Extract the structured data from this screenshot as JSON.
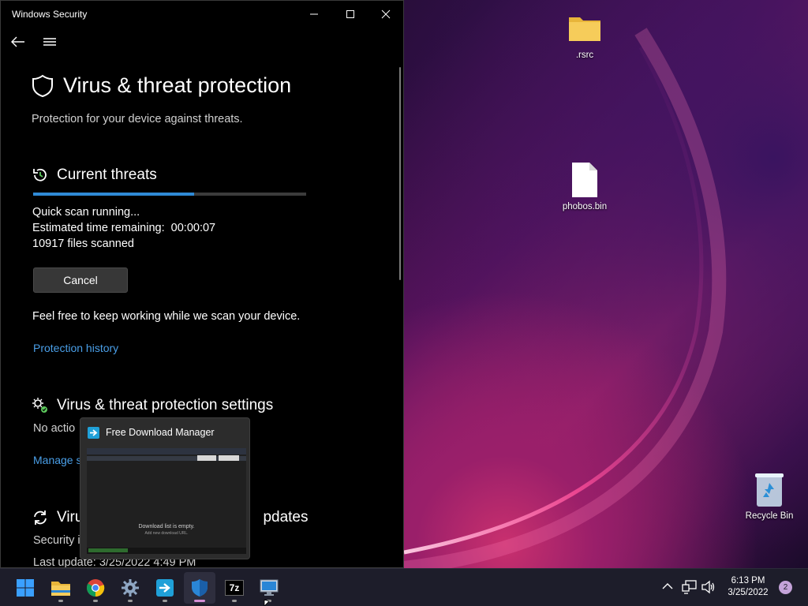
{
  "window": {
    "title": "Windows Security",
    "page_title": "Virus & threat protection",
    "subtitle": "Protection for your device against threats."
  },
  "current_threats": {
    "heading": "Current threats",
    "scan_progress_percent": 59,
    "status": "Quick scan running...",
    "time_remaining_label": "Estimated time remaining:",
    "time_remaining_value": "00:00:07",
    "files_scanned": "10917 files scanned",
    "cancel_label": "Cancel",
    "keep_working_note": "Feel free to keep working while we scan your device.",
    "protection_history_link": "Protection history"
  },
  "settings_section": {
    "heading": "Virus & threat protection settings",
    "status_partial": "No actio",
    "manage_link_partial": "Manage s"
  },
  "updates_section": {
    "heading_left": "Viru",
    "heading_right": "pdates",
    "status_partial": "Security i",
    "last_update": "Last update: 3/25/2022 4:49 PM"
  },
  "thumbnail": {
    "app_name": "Free Download Manager",
    "empty_message": "Download list is empty.",
    "empty_hint": "Add new download URL."
  },
  "desktop": {
    "icons": [
      {
        "label": ".rsrc",
        "type": "folder-icon"
      },
      {
        "label": "phobos.bin",
        "type": "file-icon"
      },
      {
        "label": "Recycle Bin",
        "type": "recycle-bin-icon"
      }
    ]
  },
  "taskbar": {
    "apps": [
      "start-icon",
      "file-explorer-icon",
      "chrome-icon",
      "settings-icon",
      "free-download-manager-icon",
      "windows-security-icon",
      "7zip-icon",
      "remote-desktop-icon"
    ],
    "time": "6:13 PM",
    "date": "3/25/2022",
    "notification_count": "2",
    "seven_zip_label": "7z"
  },
  "colors": {
    "accent": "#2f8ad6",
    "link": "#4a9fe8",
    "window_bg": "#000000",
    "taskbar_bg": "#1d1d2a"
  }
}
